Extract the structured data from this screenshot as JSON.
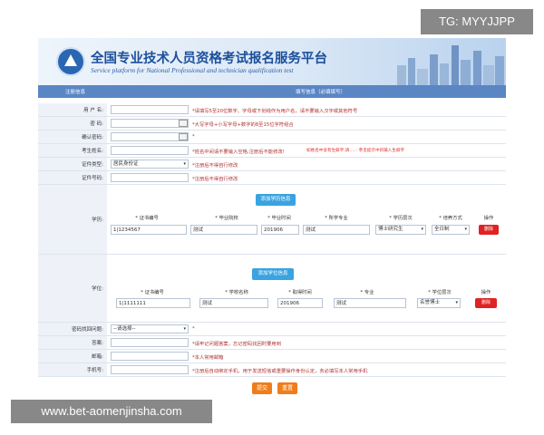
{
  "watermarks": {
    "top": "TG: MYYJJPP",
    "bottom": "www.bet-aomenjinsha.com"
  },
  "header": {
    "title_cn": "全国专业技术人员资格考试报名服务平台",
    "title_en": "Service platform for National Professional and technician  qualification test"
  },
  "colors": {
    "bar": "#5a86c4",
    "label_bg": "#eef2f8",
    "add_button": "#3aa3e0",
    "delete_button": "#e02222",
    "submit_button": "#f07d1a"
  },
  "tabs": {
    "left": "注册信息",
    "right": "填写信息（必填填写）"
  },
  "form": {
    "username": {
      "label": "用 户 名:",
      "value": "",
      "note": "*请填写5至20位数字、字母或下划线作为用户名，请不要输入汉字或其他符号"
    },
    "password": {
      "label": "密    码:",
      "value": "",
      "note": "*大写字母+小写字母+数字的8至15位字符组合"
    },
    "confirm_password": {
      "label": "确认密码:",
      "value": "",
      "note": "*"
    },
    "name": {
      "label": "考生姓名:",
      "value": "",
      "note": "*姓名中间请不要输入空格,注册后不能修改!",
      "note2": "如姓名中含有生僻字,请...... 参见提示中的输入生僻字"
    },
    "id_type": {
      "label": "证件类型:",
      "value": "居民身份证",
      "note": "*注册后不得自行修改"
    },
    "id_number": {
      "label": "证件号码:",
      "value": "",
      "note": "*注册后不得自行修改"
    },
    "education": {
      "label": "学历:",
      "add_button": "添加学历信息",
      "columns": [
        "* 证书编号",
        "* 毕业院校",
        "* 毕业时间",
        "* 所学专业",
        "* 学历层次",
        "* 培养方式",
        "操作"
      ],
      "row": {
        "cert": "1|1234567",
        "school": "测试",
        "time": "201906",
        "major": "测试",
        "level": "博士研究生",
        "mode": "全日制",
        "delete": "删除"
      }
    },
    "degree": {
      "label": "学位:",
      "add_button": "添加学位信息",
      "columns": [
        "* 证书编号",
        "* 学校名称",
        "* 取得时间",
        "* 专业",
        "* 学位层次",
        "操作"
      ],
      "row": {
        "cert": "1|1111111",
        "school": "测试",
        "time": "201906",
        "major": "测试",
        "level": "名誉博士",
        "delete": "删除"
      }
    },
    "security_question": {
      "label": "密码找回问题:",
      "value": "--请选择--",
      "note": "*"
    },
    "answer": {
      "label": "答案:",
      "value": "",
      "note": "*请牢记问题答案，忘记密码找回时要用到"
    },
    "email": {
      "label": "邮箱:",
      "value": "",
      "note": "*本人常用邮箱"
    },
    "phone": {
      "label": "手机号:",
      "value": "",
      "note": "*注册后自动绑定手机，用于发送短信或重要操作身份认定，务必填写本人常用手机"
    }
  },
  "buttons": {
    "submit": "提交",
    "reset": "重置"
  }
}
